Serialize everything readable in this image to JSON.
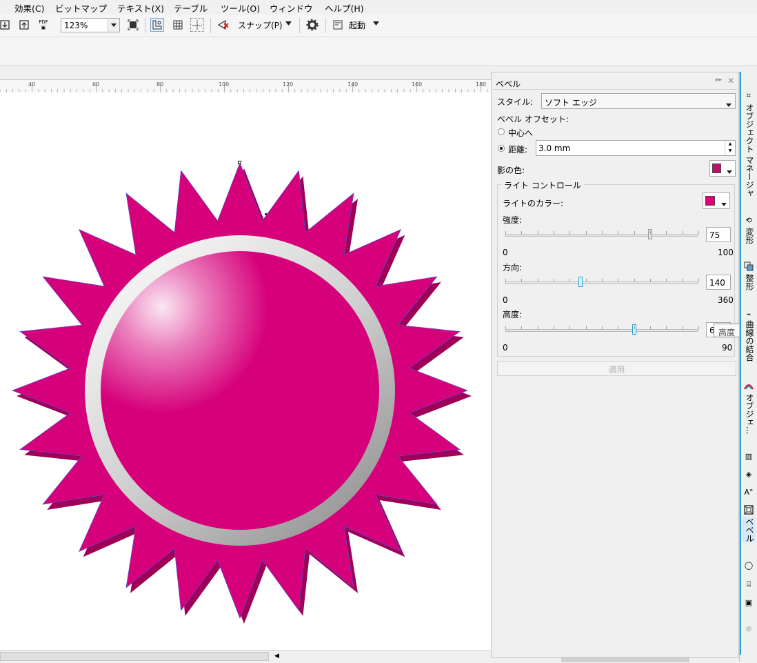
{
  "menu": [
    "効果(C)",
    "ビットマップ",
    "テキスト(X)",
    "テーブル",
    "ツール(O)",
    "ウィンドウ",
    "ヘルプ(H)"
  ],
  "toolbar": {
    "zoom_value": "123%",
    "pdf_label": "PDF",
    "snap_label": "スナップ(P)",
    "launch_label": "起動"
  },
  "ruler": [
    "40",
    "60",
    "80",
    "100",
    "120",
    "140",
    "160",
    "180"
  ],
  "docker": {
    "title": "ベベル",
    "style_label": "スタイル:",
    "style_value": "ソフト エッジ",
    "offset_label": "ベベル オフセット:",
    "to_center_label": "中心へ",
    "distance_label": "距離:",
    "distance_value": "3.0 mm",
    "shadow_color_label": "影の色:",
    "shadow_color": "#c0106e",
    "light_group_label": "ライト コントロール",
    "light_color_label": "ライトのカラー:",
    "light_color": "#e0007a",
    "intensity_label": "強度:",
    "intensity_value": "75",
    "intensity_min": "0",
    "intensity_max": "100",
    "direction_label": "方向:",
    "direction_value": "140",
    "direction_min": "0",
    "direction_max": "360",
    "altitude_label": "高度:",
    "altitude_value": "60",
    "altitude_min": "0",
    "altitude_max": "90",
    "tooltip": "高度",
    "apply_label": "適用"
  },
  "side_tabs": [
    "オブジェクト マネージャ",
    "変形",
    "整形",
    "曲線の結合",
    "オブジェ...",
    "ベベル"
  ],
  "colors": {
    "magenta": "#d6007a",
    "magenta_dark": "#a8005e",
    "accent_blue": "#2aa0d8",
    "ring_light": "#f2f2f2",
    "ring_dark": "#9a9a9a"
  }
}
